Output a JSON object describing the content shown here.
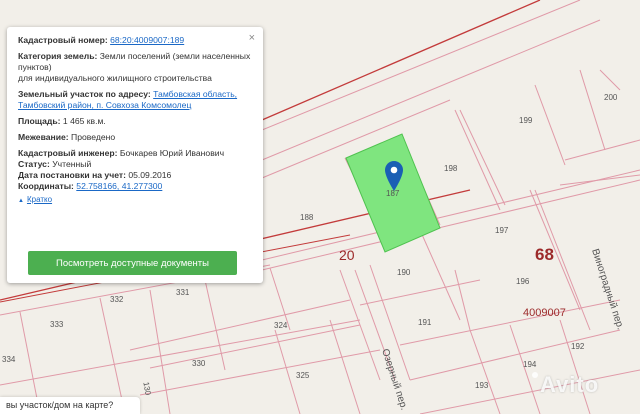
{
  "map": {
    "parcels": [
      "199",
      "200",
      "198",
      "188",
      "187",
      "197",
      "190",
      "196",
      "191",
      "194",
      "193",
      "192",
      "332",
      "331",
      "333",
      "324",
      "334",
      "330",
      "325",
      "130"
    ],
    "block_numbers": [
      "20",
      "68"
    ],
    "cadastral_block": "4009007",
    "streets": [
      "Озерный пер.",
      "Виноградный пер."
    ]
  },
  "popup": {
    "cadastral_number_label": "Кадастровый номер:",
    "cadastral_number": "68:20:4009007:189",
    "category_label": "Категория земель:",
    "category_value": "Земли поселений (земли населенных пунктов)",
    "category_use": "для индивидуального жилищного строительства",
    "address_label": "Земельный участок по адресу:",
    "address_line1": "Тамбовская область,",
    "address_line2": "Тамбовский район, п. Совхоза Комсомолец",
    "area_label": "Площадь:",
    "area_value": "1 465 кв.м.",
    "survey_label": "Межевание:",
    "survey_value": "Проведено",
    "engineer_label": "Кадастровый инженер:",
    "engineer_value": "Бочкарев Юрий Иванович",
    "status_label": "Статус:",
    "status_value": "Учтенный",
    "registration_label": "Дата постановки на учет:",
    "registration_value": "05.09.2016",
    "coords_label": "Координаты:",
    "coords_value": "52.758166, 41.277300",
    "collapse_link": "Кратко",
    "docs_button": "Посмотреть доступные документы",
    "close_glyph": "×"
  },
  "bottom_bar": {
    "text": "вы участок/дом на карте?"
  },
  "watermark": {
    "text": "Avito"
  },
  "icons": {
    "pin": "map-pin-icon",
    "close": "close-icon",
    "collapse": "chevron-up-icon"
  },
  "colors": {
    "background": "#f2efe9",
    "parcel_border": "#e09aa8",
    "road_line": "#c33b3b",
    "selected_parcel": "#7fe57f",
    "pin": "#1a5fb4",
    "link": "#1a68c6",
    "button": "#4caf50"
  }
}
